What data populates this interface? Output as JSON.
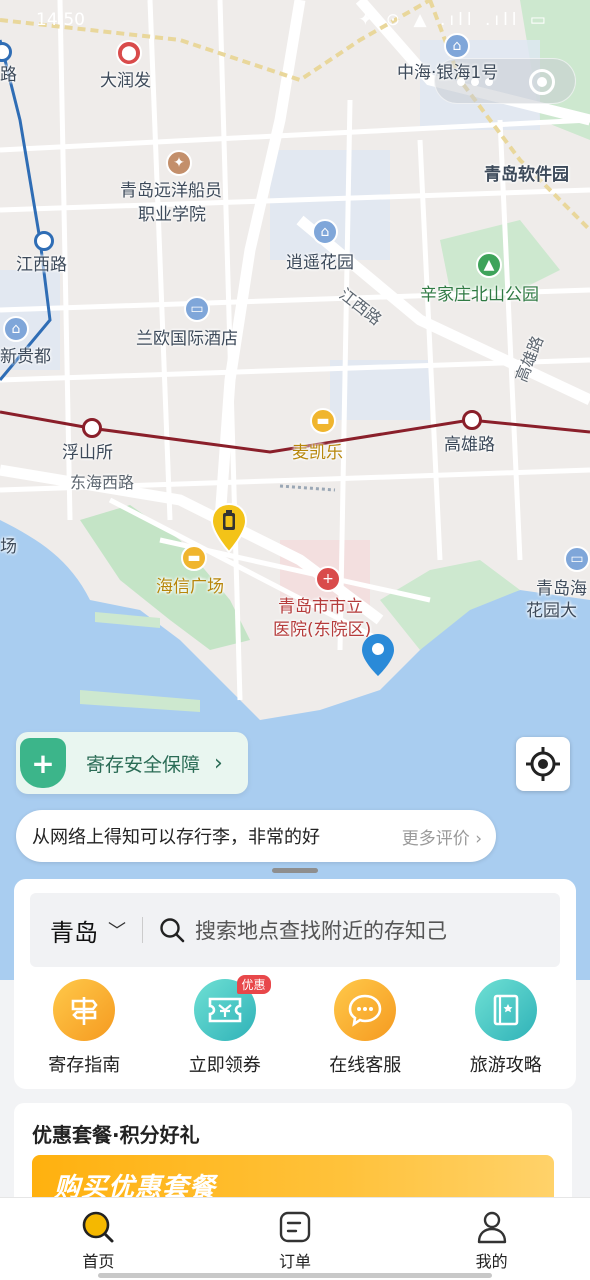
{
  "status_bar": {
    "time": "14:50",
    "icons": "✦ ⊙ ▲ .ıll .ıll ▭"
  },
  "map": {
    "places": {
      "runfa": "大润发",
      "yinhai": "中海·银海1号",
      "software_park": "青岛软件园",
      "seamen_college_l1": "青岛远洋船员",
      "seamen_college_l2": "职业学院",
      "xiaoyao_garden": "逍遥花园",
      "xinjia_park": "辛家庄北山公园",
      "jiangxi_station": "江西路",
      "jiangxi_road": "江西路",
      "lanou_hotel": "兰欧国际酒店",
      "xingui": "新贵都",
      "gaoxiong_road_v": "高雄路",
      "fushansuo": "浮山所",
      "gaoxiong_station": "高雄路",
      "mcdonalds": "麦凯乐",
      "donghai_west": "东海西路",
      "hisense_plaza": "海信广场",
      "hospital_l1": "青岛市市立",
      "hospital_l2": "医院(东院区)",
      "qingdao_sea_l1": "青岛海",
      "qingdao_sea_l2": "花园大",
      "edge_left_top": "路",
      "edge_left_mid": "场"
    }
  },
  "safety_chip": {
    "label": "寄存安全保障",
    "icon": "shield-plus-icon"
  },
  "review_bar": {
    "text": "从网络上得知可以存行李，非常的好",
    "more": "更多评价"
  },
  "search": {
    "city": "青岛",
    "placeholder": "搜索地点查找附近的存知己"
  },
  "shortcuts": [
    {
      "label": "寄存指南",
      "icon": "signpost-icon",
      "color": "orange"
    },
    {
      "label": "立即领券",
      "icon": "ticket-icon",
      "color": "teal",
      "badge": "优惠"
    },
    {
      "label": "在线客服",
      "icon": "chat-bubble-icon",
      "color": "orange"
    },
    {
      "label": "旅游攻略",
      "icon": "guidebook-icon",
      "color": "teal"
    }
  ],
  "promo": {
    "title": "优惠套餐·积分好礼",
    "banner_text": "购买优惠套餐"
  },
  "tabs": [
    {
      "label": "首页",
      "icon": "search-home-icon",
      "active": true
    },
    {
      "label": "订单",
      "icon": "order-icon",
      "active": false
    },
    {
      "label": "我的",
      "icon": "person-icon",
      "active": false
    }
  ],
  "colors": {
    "accent": "#f5b800",
    "teal": "#3cb58a",
    "metro_red": "#8a1f2a",
    "metro_blue": "#2f6db5",
    "water": "#a9cdf0"
  }
}
